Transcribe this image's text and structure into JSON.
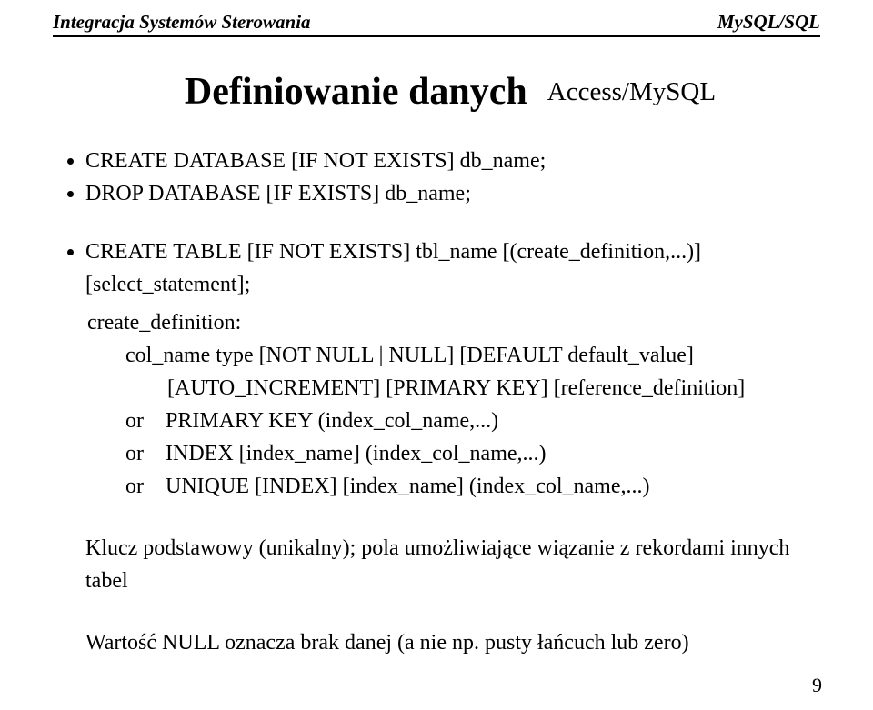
{
  "header": {
    "left": "Integracja Systemów Sterowania",
    "right": "MySQL/SQL"
  },
  "title": "Definiowanie danych",
  "subtitle": "Access/MySQL",
  "bullets": {
    "b1": "CREATE DATABASE [IF NOT EXISTS] db_name;",
    "b2": "DROP DATABASE [IF EXISTS] db_name;",
    "b3": "CREATE TABLE [IF NOT EXISTS] tbl_name [(create_definition,...)] [select_statement];"
  },
  "def": {
    "label": "create_definition:",
    "l1": "col_name type [NOT NULL | NULL] [DEFAULT default_value]",
    "l1b": "[AUTO_INCREMENT] [PRIMARY KEY] [reference_definition]",
    "or1": {
      "kw": "or",
      "text": "PRIMARY KEY (index_col_name,...)"
    },
    "or2": {
      "kw": "or",
      "text": "INDEX [index_name] (index_col_name,...)"
    },
    "or3": {
      "kw": "or",
      "text": "UNIQUE [INDEX] [index_name] (index_col_name,...)"
    }
  },
  "notes": {
    "n1": "Klucz podstawowy (unikalny); pola umożliwiające wiązanie z rekordami innych tabel",
    "n2": "Wartość NULL oznacza brak danej (a nie np. pusty łańcuch lub zero)"
  },
  "page_number": "9"
}
